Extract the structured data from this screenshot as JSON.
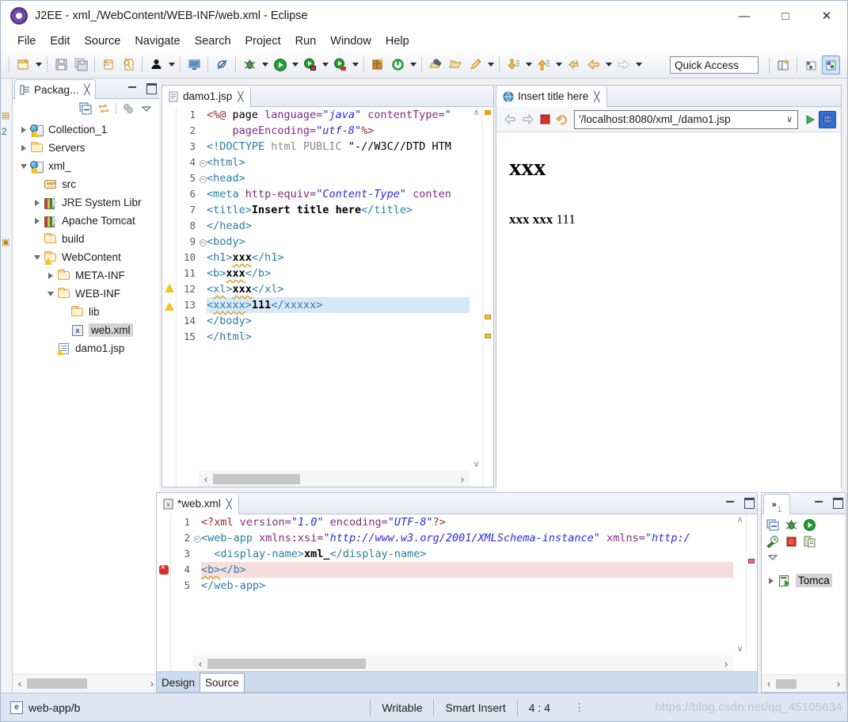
{
  "window": {
    "title": "J2EE - xml_/WebContent/WEB-INF/web.xml - Eclipse",
    "app_icon": "eclipse-icon",
    "minimize": "—",
    "maximize": "□",
    "close": "✕"
  },
  "menu": {
    "items": [
      "File",
      "Edit",
      "Source",
      "Navigate",
      "Search",
      "Project",
      "Run",
      "Window",
      "Help"
    ]
  },
  "toolbar": {
    "quick_access_placeholder": "Quick Access",
    "buttons": [
      {
        "name": "new-wizard-icon",
        "dropdown": true
      },
      {
        "name": "save-icon",
        "dropdown": false
      },
      {
        "name": "save-all-icon",
        "dropdown": false
      },
      {
        "name": "print-icon",
        "dropdown": false
      },
      {
        "name": "validate-icon",
        "dropdown": false
      },
      {
        "name": "person-icon",
        "dropdown": true
      },
      {
        "name": "console-icon",
        "dropdown": false
      },
      {
        "name": "skip-breakpoints-icon",
        "dropdown": false
      },
      {
        "name": "debug-icon",
        "dropdown": true
      },
      {
        "name": "run-icon",
        "dropdown": true
      },
      {
        "name": "run-server-icon",
        "dropdown": true
      },
      {
        "name": "profile-server-icon",
        "dropdown": true
      },
      {
        "name": "new-package-icon",
        "dropdown": false
      },
      {
        "name": "refresh-icon",
        "dropdown": true
      },
      {
        "name": "open-type-icon",
        "dropdown": false
      },
      {
        "name": "open-resource-icon",
        "dropdown": false
      },
      {
        "name": "search-pencil-icon",
        "dropdown": true
      },
      {
        "name": "next-annotation-icon",
        "dropdown": true
      },
      {
        "name": "previous-annotation-icon",
        "dropdown": true
      },
      {
        "name": "back-history-icon",
        "dropdown": false
      },
      {
        "name": "back-icon",
        "dropdown": true
      },
      {
        "name": "forward-icon",
        "dropdown": true
      }
    ],
    "right_buttons": [
      {
        "name": "open-perspective-icon"
      },
      {
        "name": "perspective-java-ee-icon"
      },
      {
        "name": "perspective-active-icon"
      }
    ]
  },
  "package_explorer": {
    "tab_label": "Packag...",
    "tab_icon": "package-explorer-icon",
    "close_glyph": "╳",
    "toolbar_icons": [
      "collapse-all-icon",
      "link-with-editor-icon",
      "focus-icon",
      "view-menu-icon"
    ],
    "tree": [
      {
        "label": "Collection_1",
        "indent": 0,
        "twisty": "collapsed",
        "icon": "java-project-icon",
        "selected": false
      },
      {
        "label": "Servers",
        "indent": 0,
        "twisty": "collapsed",
        "icon": "folder-icon",
        "selected": false
      },
      {
        "label": "xml_",
        "indent": 0,
        "twisty": "expanded",
        "icon": "java-project-icon",
        "selected": false
      },
      {
        "label": "src",
        "indent": 1,
        "twisty": "none",
        "icon": "source-folder-icon",
        "selected": false
      },
      {
        "label": "JRE System Libr",
        "indent": 1,
        "twisty": "collapsed",
        "icon": "library-icon",
        "selected": false
      },
      {
        "label": "Apache Tomcat",
        "indent": 1,
        "twisty": "collapsed",
        "icon": "library-icon",
        "selected": false
      },
      {
        "label": "build",
        "indent": 1,
        "twisty": "none",
        "icon": "folder-icon",
        "selected": false
      },
      {
        "label": "WebContent",
        "indent": 1,
        "twisty": "expanded",
        "icon": "folder-warn-icon",
        "selected": false
      },
      {
        "label": "META-INF",
        "indent": 2,
        "twisty": "collapsed",
        "icon": "folder-icon",
        "selected": false
      },
      {
        "label": "WEB-INF",
        "indent": 2,
        "twisty": "expanded",
        "icon": "folder-icon",
        "selected": false
      },
      {
        "label": "lib",
        "indent": 3,
        "twisty": "none",
        "icon": "folder-icon",
        "selected": false
      },
      {
        "label": "web.xml",
        "indent": 3,
        "twisty": "none",
        "icon": "xml-file-icon",
        "selected": true
      },
      {
        "label": "damo1.jsp",
        "indent": 2,
        "twisty": "none",
        "icon": "jsp-file-warn-icon",
        "selected": false
      }
    ]
  },
  "jsp_editor": {
    "tab_label": "damo1.jsp",
    "tab_icon": "jsp-file-icon",
    "close_glyph": "╳",
    "lines": [
      {
        "no": "1",
        "fold": "",
        "marker": "",
        "selected": false,
        "segs": [
          {
            "t": "<%@ ",
            "c": "dir"
          },
          {
            "t": "page ",
            "c": "plain"
          },
          {
            "t": "language=",
            "c": "attr"
          },
          {
            "t": "\"java\"",
            "c": "val"
          },
          {
            "t": " contentType=",
            "c": "attr"
          },
          {
            "t": "\"",
            "c": "val"
          }
        ]
      },
      {
        "no": "2",
        "fold": "",
        "marker": "",
        "selected": false,
        "segs": [
          {
            "t": "    pageEncoding=",
            "c": "attr"
          },
          {
            "t": "\"utf-8\"",
            "c": "val"
          },
          {
            "t": "%>",
            "c": "dir"
          }
        ]
      },
      {
        "no": "3",
        "fold": "",
        "marker": "",
        "selected": false,
        "segs": [
          {
            "t": "<!DOCTYPE ",
            "c": "tag"
          },
          {
            "t": "html PUBLIC ",
            "c": "doctype"
          },
          {
            "t": "\"-//W3C//DTD HTM",
            "c": "plain"
          }
        ]
      },
      {
        "no": "4",
        "fold": "⊖",
        "marker": "",
        "selected": false,
        "segs": [
          {
            "t": "<html>",
            "c": "tag"
          }
        ]
      },
      {
        "no": "5",
        "fold": "⊖",
        "marker": "",
        "selected": false,
        "segs": [
          {
            "t": "<head>",
            "c": "tag"
          }
        ]
      },
      {
        "no": "6",
        "fold": "",
        "marker": "",
        "selected": false,
        "segs": [
          {
            "t": "<meta ",
            "c": "tag"
          },
          {
            "t": "http-equiv=",
            "c": "attr"
          },
          {
            "t": "\"Content-Type\"",
            "c": "val"
          },
          {
            "t": " conten",
            "c": "attr"
          }
        ]
      },
      {
        "no": "7",
        "fold": "",
        "marker": "",
        "selected": false,
        "segs": [
          {
            "t": "<title>",
            "c": "tag"
          },
          {
            "t": "Insert title here",
            "c": "txt"
          },
          {
            "t": "</title>",
            "c": "tag"
          }
        ]
      },
      {
        "no": "8",
        "fold": "",
        "marker": "",
        "selected": false,
        "segs": [
          {
            "t": "</head>",
            "c": "tag"
          }
        ]
      },
      {
        "no": "9",
        "fold": "⊖",
        "marker": "",
        "selected": false,
        "segs": [
          {
            "t": "<body>",
            "c": "tag"
          }
        ]
      },
      {
        "no": "10",
        "fold": "",
        "marker": "",
        "selected": false,
        "segs": [
          {
            "t": "<h1>",
            "c": "tag"
          },
          {
            "t": "xxx",
            "c": "txt squiggle"
          },
          {
            "t": "</h1>",
            "c": "tag"
          }
        ]
      },
      {
        "no": "11",
        "fold": "",
        "marker": "",
        "selected": false,
        "segs": [
          {
            "t": "<b>",
            "c": "tag"
          },
          {
            "t": "xxx",
            "c": "txt squiggle"
          },
          {
            "t": "</b>",
            "c": "tag"
          }
        ]
      },
      {
        "no": "12",
        "fold": "",
        "marker": "warning",
        "selected": false,
        "segs": [
          {
            "t": "<",
            "c": "tag"
          },
          {
            "t": "xl",
            "c": "tag squiggle"
          },
          {
            "t": ">",
            "c": "tag"
          },
          {
            "t": "xxx",
            "c": "txt squiggle"
          },
          {
            "t": "</xl>",
            "c": "tag"
          }
        ]
      },
      {
        "no": "13",
        "fold": "",
        "marker": "warning",
        "selected": true,
        "segs": [
          {
            "t": "<",
            "c": "tag"
          },
          {
            "t": "xxxxx",
            "c": "tag squiggle"
          },
          {
            "t": ">",
            "c": "tag"
          },
          {
            "t": "111",
            "c": "txt"
          },
          {
            "t": "</xxxxx>",
            "c": "tag"
          }
        ]
      },
      {
        "no": "14",
        "fold": "",
        "marker": "",
        "selected": false,
        "segs": [
          {
            "t": "</body>",
            "c": "tag"
          }
        ]
      },
      {
        "no": "15",
        "fold": "",
        "marker": "",
        "selected": false,
        "segs": [
          {
            "t": "</html>",
            "c": "tag"
          }
        ]
      }
    ],
    "scroll_up_glyph": "∧",
    "scroll_down_glyph": "∨",
    "hscroll_left_glyph": "‹",
    "hscroll_right_glyph": "›"
  },
  "browser": {
    "tab_label": "Insert title here",
    "tab_icon": "globe-icon",
    "close_glyph": "╳",
    "back_icon": "back-arrow-icon",
    "forward_icon": "forward-arrow-icon",
    "stop_icon": "stop-icon",
    "refresh_icon": "refresh-icon",
    "url": "'/localhost:8080/xml_/damo1.jsp",
    "url_dropdown_glyph": "∨",
    "go_icon": "go-play-icon",
    "open_external_icon": "open-external-browser-icon",
    "page_heading": "xxx",
    "page_body_bold": "xxx xxx",
    "page_body_plain": "111"
  },
  "xml_editor": {
    "tab_label": "*web.xml",
    "tab_icon": "xml-file-icon",
    "close_glyph": "╳",
    "lines": [
      {
        "no": "1",
        "fold": "",
        "marker": "",
        "selected": false,
        "error": false,
        "segs": [
          {
            "t": "<?xml ",
            "c": "dir"
          },
          {
            "t": "version=",
            "c": "attr"
          },
          {
            "t": "\"1.0\"",
            "c": "val"
          },
          {
            "t": " encoding=",
            "c": "attr"
          },
          {
            "t": "\"UTF-8\"",
            "c": "val"
          },
          {
            "t": "?>",
            "c": "dir"
          }
        ]
      },
      {
        "no": "2",
        "fold": "⊖",
        "marker": "",
        "selected": false,
        "error": false,
        "segs": [
          {
            "t": "<web-app ",
            "c": "tag"
          },
          {
            "t": "xmlns:xsi=",
            "c": "attr"
          },
          {
            "t": "\"http://www.w3.org/2001/XMLSchema-instance\"",
            "c": "val"
          },
          {
            "t": " xmlns=",
            "c": "attr"
          },
          {
            "t": "\"http:/",
            "c": "val"
          }
        ]
      },
      {
        "no": "3",
        "fold": "",
        "marker": "",
        "selected": false,
        "error": false,
        "segs": [
          {
            "t": "  <display-name>",
            "c": "tag"
          },
          {
            "t": "xml_",
            "c": "txt"
          },
          {
            "t": "</display-name>",
            "c": "tag"
          }
        ]
      },
      {
        "no": "4",
        "fold": "",
        "marker": "error",
        "selected": true,
        "error": true,
        "segs": [
          {
            "t": "<b>",
            "c": "tag squiggle"
          },
          {
            "t": "</b>",
            "c": "tag"
          }
        ]
      },
      {
        "no": "5",
        "fold": "",
        "marker": "",
        "selected": false,
        "error": false,
        "segs": [
          {
            "t": "</web-app>",
            "c": "tag"
          }
        ]
      }
    ],
    "design_tab": "Design",
    "source_tab": "Source",
    "active_tab": "Source"
  },
  "servers_panel": {
    "tab_label": "»",
    "tab_badge": "1",
    "toolbar_icons_row1": [
      "console-icon",
      "debug-server-icon",
      "start-server-icon"
    ],
    "toolbar_icons_row2": [
      "profile-server-icon",
      "stop-server-icon",
      "publish-icon"
    ],
    "view_menu_icon": "view-menu-icon",
    "items": [
      {
        "label": "Tomca",
        "icon": "server-icon",
        "twisty": "collapsed",
        "selected": true
      }
    ]
  },
  "status_bar": {
    "selection_icon": "element-icon",
    "selection_path": "web-app/b",
    "writable": "Writable",
    "insert_mode": "Smart Insert",
    "cursor_position": "4 : 4",
    "watermark": "https://blog.csdn.net/qq_45105634"
  },
  "colors": {
    "accent": "#d9e8f7",
    "tag": "#2a7fa0",
    "attr_value": "#2a2ae0",
    "attr_name": "#7f2b7f",
    "directive": "#9a2b2b",
    "error_bg": "#f6dede",
    "status_bar_bg": "#dde6f2"
  }
}
